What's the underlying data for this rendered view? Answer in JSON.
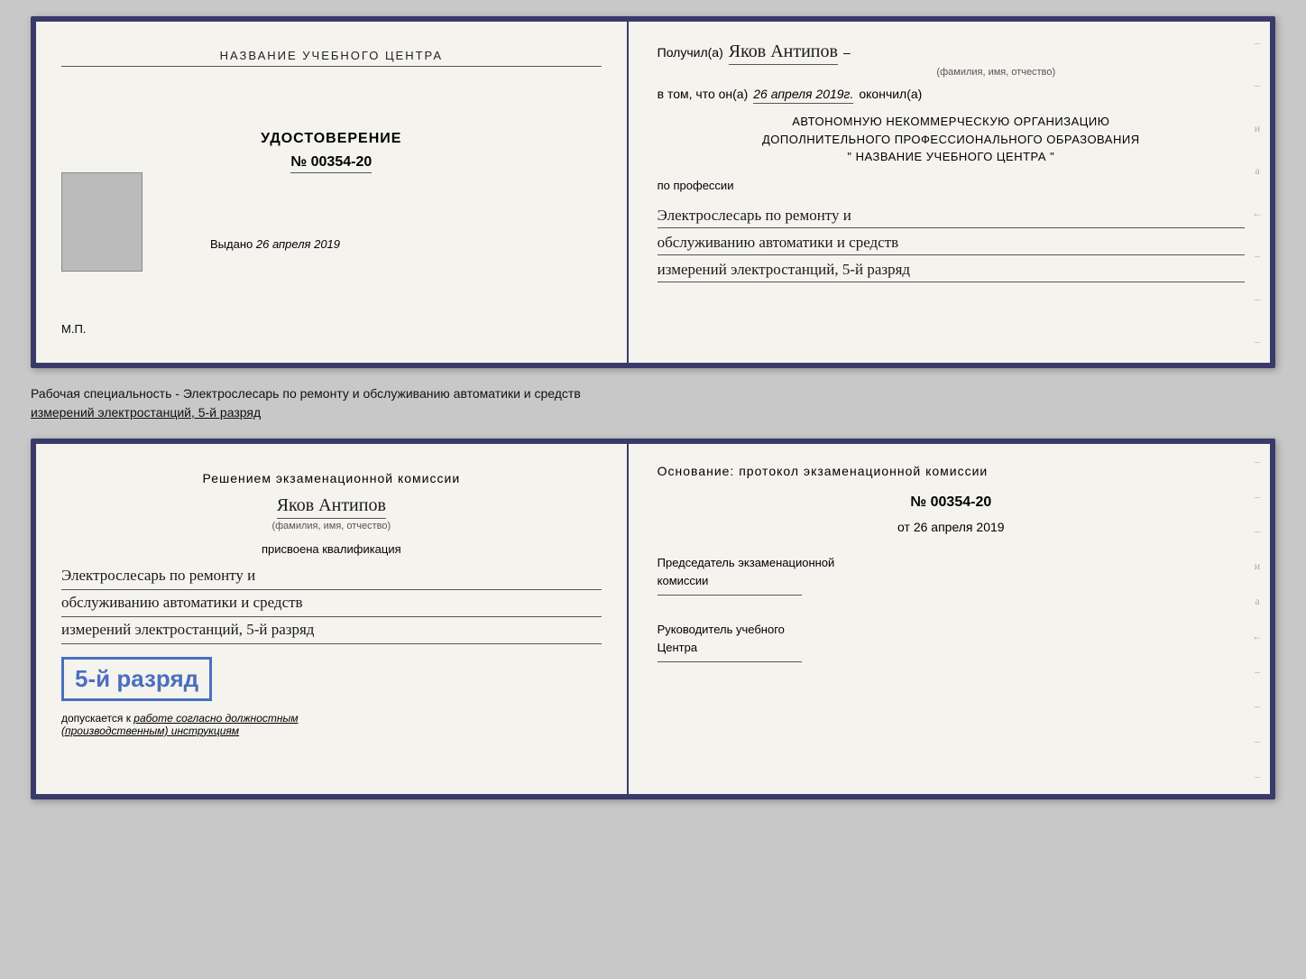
{
  "top_cert": {
    "left": {
      "org_name": "НАЗВАНИЕ УЧЕБНОГО ЦЕНТРА",
      "udostoverenie": "УДОСТОВЕРЕНИЕ",
      "number": "№ 00354-20",
      "vydano_label": "Выдано",
      "vydano_date": "26 апреля 2019",
      "mp": "М.П."
    },
    "right": {
      "poluchil_label": "Получил(а)",
      "recipient_name": "Яков Антипов",
      "fio_label": "(фамилия, имя, отчество)",
      "vtom_label": "в том, что он(а)",
      "date_value": "26 апреля 2019г.",
      "okonchil": "окончил(а)",
      "org_line1": "АВТОНОМНУЮ НЕКОММЕРЧЕСКУЮ ОРГАНИЗАЦИЮ",
      "org_line2": "ДОПОЛНИТЕЛЬНОГО ПРОФЕССИОНАЛЬНОГО ОБРАЗОВАНИЯ",
      "org_line3": "\"   НАЗВАНИЕ УЧЕБНОГО ЦЕНТРА   \"",
      "po_professii": "по профессии",
      "profession_line1": "Электрослесарь по ремонту и",
      "profession_line2": "обслуживанию автоматики и средств",
      "profession_line3": "измерений электростанций, 5-й разряд",
      "deco_right": "и а ←"
    }
  },
  "middle": {
    "text1": "Рабочая специальность - Электрослесарь по ремонту и обслуживанию автоматики и средств",
    "text2": "измерений электростанций, 5-й разряд"
  },
  "bottom_cert": {
    "left": {
      "resheniem": "Решением экзаменационной комиссии",
      "person_name": "Яков Антипов",
      "fio_label": "(фамилия, имя, отчество)",
      "prisvoena": "присвоена квалификация",
      "qual_line1": "Электрослесарь по ремонту и",
      "qual_line2": "обслуживанию автоматики и средств",
      "qual_line3": "измерений электростанций, 5-й разряд",
      "razryad_badge": "5-й разряд",
      "dopuskaetsya_prefix": "допускается к",
      "dopuskaetsya_italic": "работе согласно должностным",
      "dopuskaetsya_italic2": "(производственным) инструкциям"
    },
    "right": {
      "osnovanie": "Основание: протокол экзаменационной комиссии",
      "protocol_number": "№ 00354-20",
      "ot_label": "от",
      "ot_date": "26 апреля 2019",
      "predsedatel_line1": "Председатель экзаменационной",
      "predsedatel_line2": "комиссии",
      "rukovoditel_line1": "Руководитель учебного",
      "rukovoditel_line2": "Центра",
      "deco": "и а ←"
    }
  }
}
